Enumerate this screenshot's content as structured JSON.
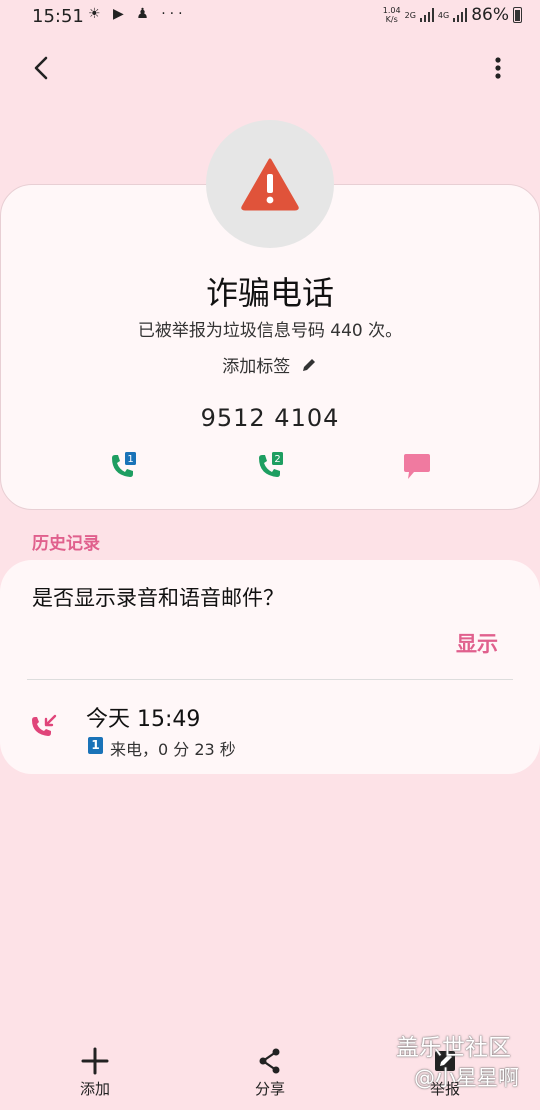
{
  "status_bar": {
    "time": "15:51",
    "left_icons": "☀ ▶ ♟ ···",
    "net_speed_top": "1.04",
    "net_speed_bottom": "K/s",
    "net_2g": "2G",
    "net_4g": "4G",
    "battery": "86%"
  },
  "contact": {
    "name": "诈骗电话",
    "report_text": "已被举报为垃圾信息号码 440 次。",
    "add_tag_label": "添加标签",
    "phone_number": "9512 4104",
    "sim1_label": "1",
    "sim2_label": "2"
  },
  "history": {
    "section_label": "历史记录",
    "recording_prompt": "是否显示录音和语音邮件？",
    "show_label": "显示",
    "call_time": "今天 15:49",
    "sim_badge": "1",
    "call_detail": "来电，0 分 23 秒"
  },
  "bottom_nav": {
    "add_label": "添加",
    "share_label": "分享",
    "report_label": "举报"
  },
  "watermark": {
    "site": "盖乐世社区",
    "user": "@小星星啊"
  },
  "colors": {
    "background": "#fde2e7",
    "accent": "#e0608d",
    "call_green": "#1e9e61",
    "warning_red": "#e0533a"
  }
}
